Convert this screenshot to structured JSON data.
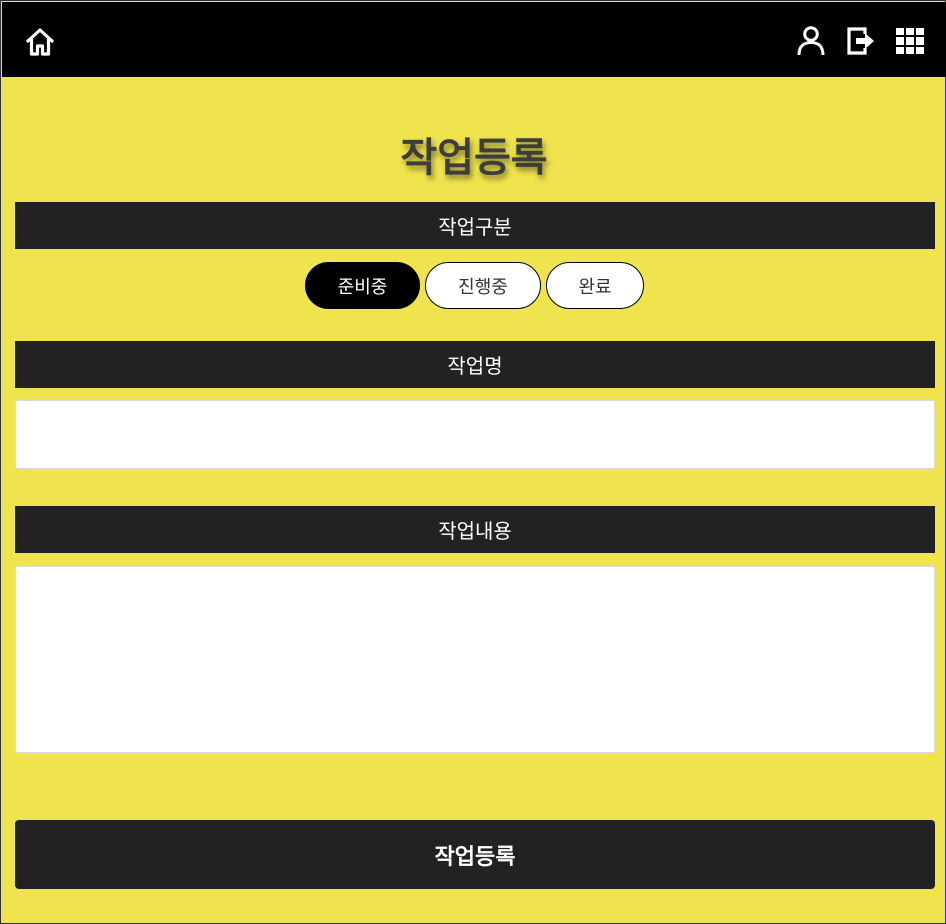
{
  "header": {
    "icons": [
      "home-icon",
      "user-icon",
      "logout-icon",
      "grid-menu-icon"
    ]
  },
  "page": {
    "title": "작업등록"
  },
  "work_type": {
    "label": "작업구분",
    "options": [
      "준비중",
      "진행중",
      "완료"
    ],
    "selected": "준비중"
  },
  "work_name": {
    "label": "작업명",
    "value": ""
  },
  "work_content": {
    "label": "작업내용",
    "value": ""
  },
  "submit": {
    "label": "작업등록"
  },
  "colors": {
    "background": "#efe44d",
    "topbar": "#000000",
    "section_bar": "#222222",
    "active_option": "#000000"
  }
}
